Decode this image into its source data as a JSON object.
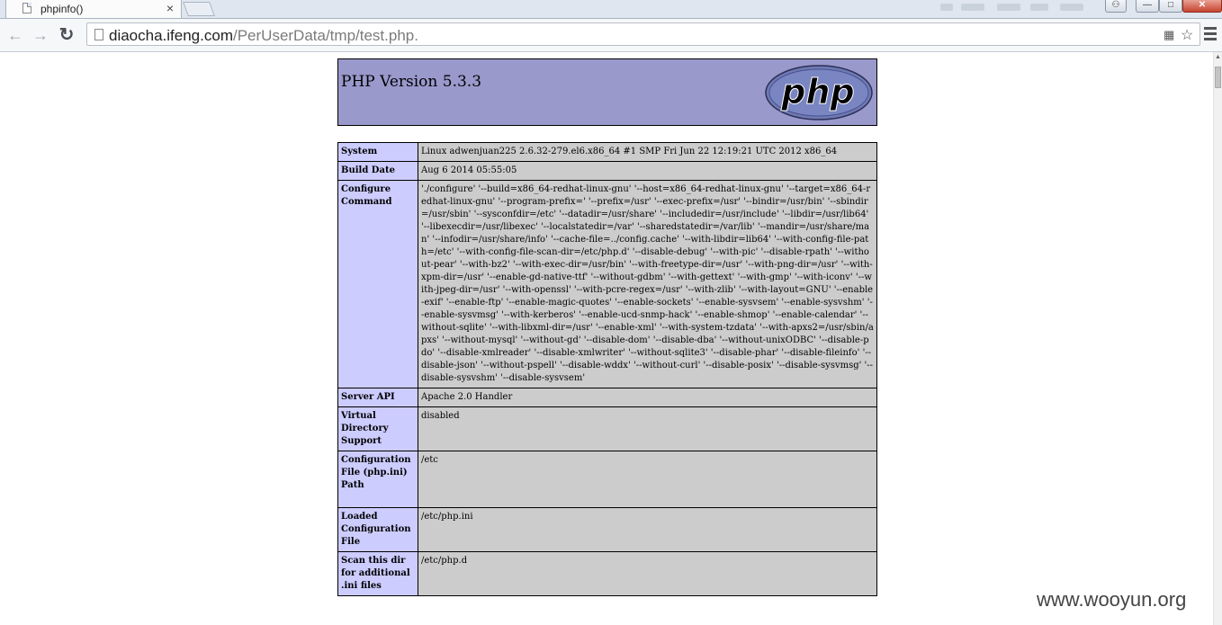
{
  "browser": {
    "tab_title": "phpinfo()",
    "tab_close": "×",
    "url_host": "diaocha.ifeng.com",
    "url_path": "/PerUserData/tmp/test.php.",
    "back": "←",
    "forward": "→",
    "reload": "↻",
    "translate_icon": "translate-icon",
    "star_icon": "☆"
  },
  "page": {
    "php_version": "PHP Version 5.3.3",
    "logo_text": "php",
    "rows": [
      {
        "label": "System",
        "value": "Linux adwenjuan225 2.6.32-279.el6.x86_64 #1 SMP Fri Jun 22 12:19:21 UTC 2012 x86_64"
      },
      {
        "label": "Build Date",
        "value": "Aug 6 2014 05:55:05"
      },
      {
        "label": "Configure Command",
        "value": "'./configure' '--build=x86_64-redhat-linux-gnu' '--host=x86_64-redhat-linux-gnu' '--target=x86_64-redhat-linux-gnu' '--program-prefix=' '--prefix=/usr' '--exec-prefix=/usr' '--bindir=/usr/bin' '--sbindir=/usr/sbin' '--sysconfdir=/etc' '--datadir=/usr/share' '--includedir=/usr/include' '--libdir=/usr/lib64' '--libexecdir=/usr/libexec' '--localstatedir=/var' '--sharedstatedir=/var/lib' '--mandir=/usr/share/man' '--infodir=/usr/share/info' '--cache-file=../config.cache' '--with-libdir=lib64' '--with-config-file-path=/etc' '--with-config-file-scan-dir=/etc/php.d' '--disable-debug' '--with-pic' '--disable-rpath' '--without-pear' '--with-bz2' '--with-exec-dir=/usr/bin' '--with-freetype-dir=/usr' '--with-png-dir=/usr' '--with-xpm-dir=/usr' '--enable-gd-native-ttf' '--without-gdbm' '--with-gettext' '--with-gmp' '--with-iconv' '--with-jpeg-dir=/usr' '--with-openssl' '--with-pcre-regex=/usr' '--with-zlib' '--with-layout=GNU' '--enable-exif' '--enable-ftp' '--enable-magic-quotes' '--enable-sockets' '--enable-sysvsem' '--enable-sysvshm' '--enable-sysvmsg' '--with-kerberos' '--enable-ucd-snmp-hack' '--enable-shmop' '--enable-calendar' '--without-sqlite' '--with-libxml-dir=/usr' '--enable-xml' '--with-system-tzdata' '--with-apxs2=/usr/sbin/apxs' '--without-mysql' '--without-gd' '--disable-dom' '--disable-dba' '--without-unixODBC' '--disable-pdo' '--disable-xmlreader' '--disable-xmlwriter' '--without-sqlite3' '--disable-phar' '--disable-fileinfo' '--disable-json' '--without-pspell' '--disable-wddx' '--without-curl' '--disable-posix' '--disable-sysvmsg' '--disable-sysvshm' '--disable-sysvsem'"
      },
      {
        "label": "Server API",
        "value": "Apache 2.0 Handler"
      },
      {
        "label": "Virtual Directory Support",
        "value": "disabled"
      },
      {
        "label": "Configuration File (php.ini) Path",
        "value": "/etc"
      },
      {
        "label": "Loaded Configuration File",
        "value": "/etc/php.ini"
      },
      {
        "label": "Scan this dir for additional .ini files",
        "value": "/etc/php.d"
      }
    ]
  },
  "watermark": "www.wooyun.org"
}
